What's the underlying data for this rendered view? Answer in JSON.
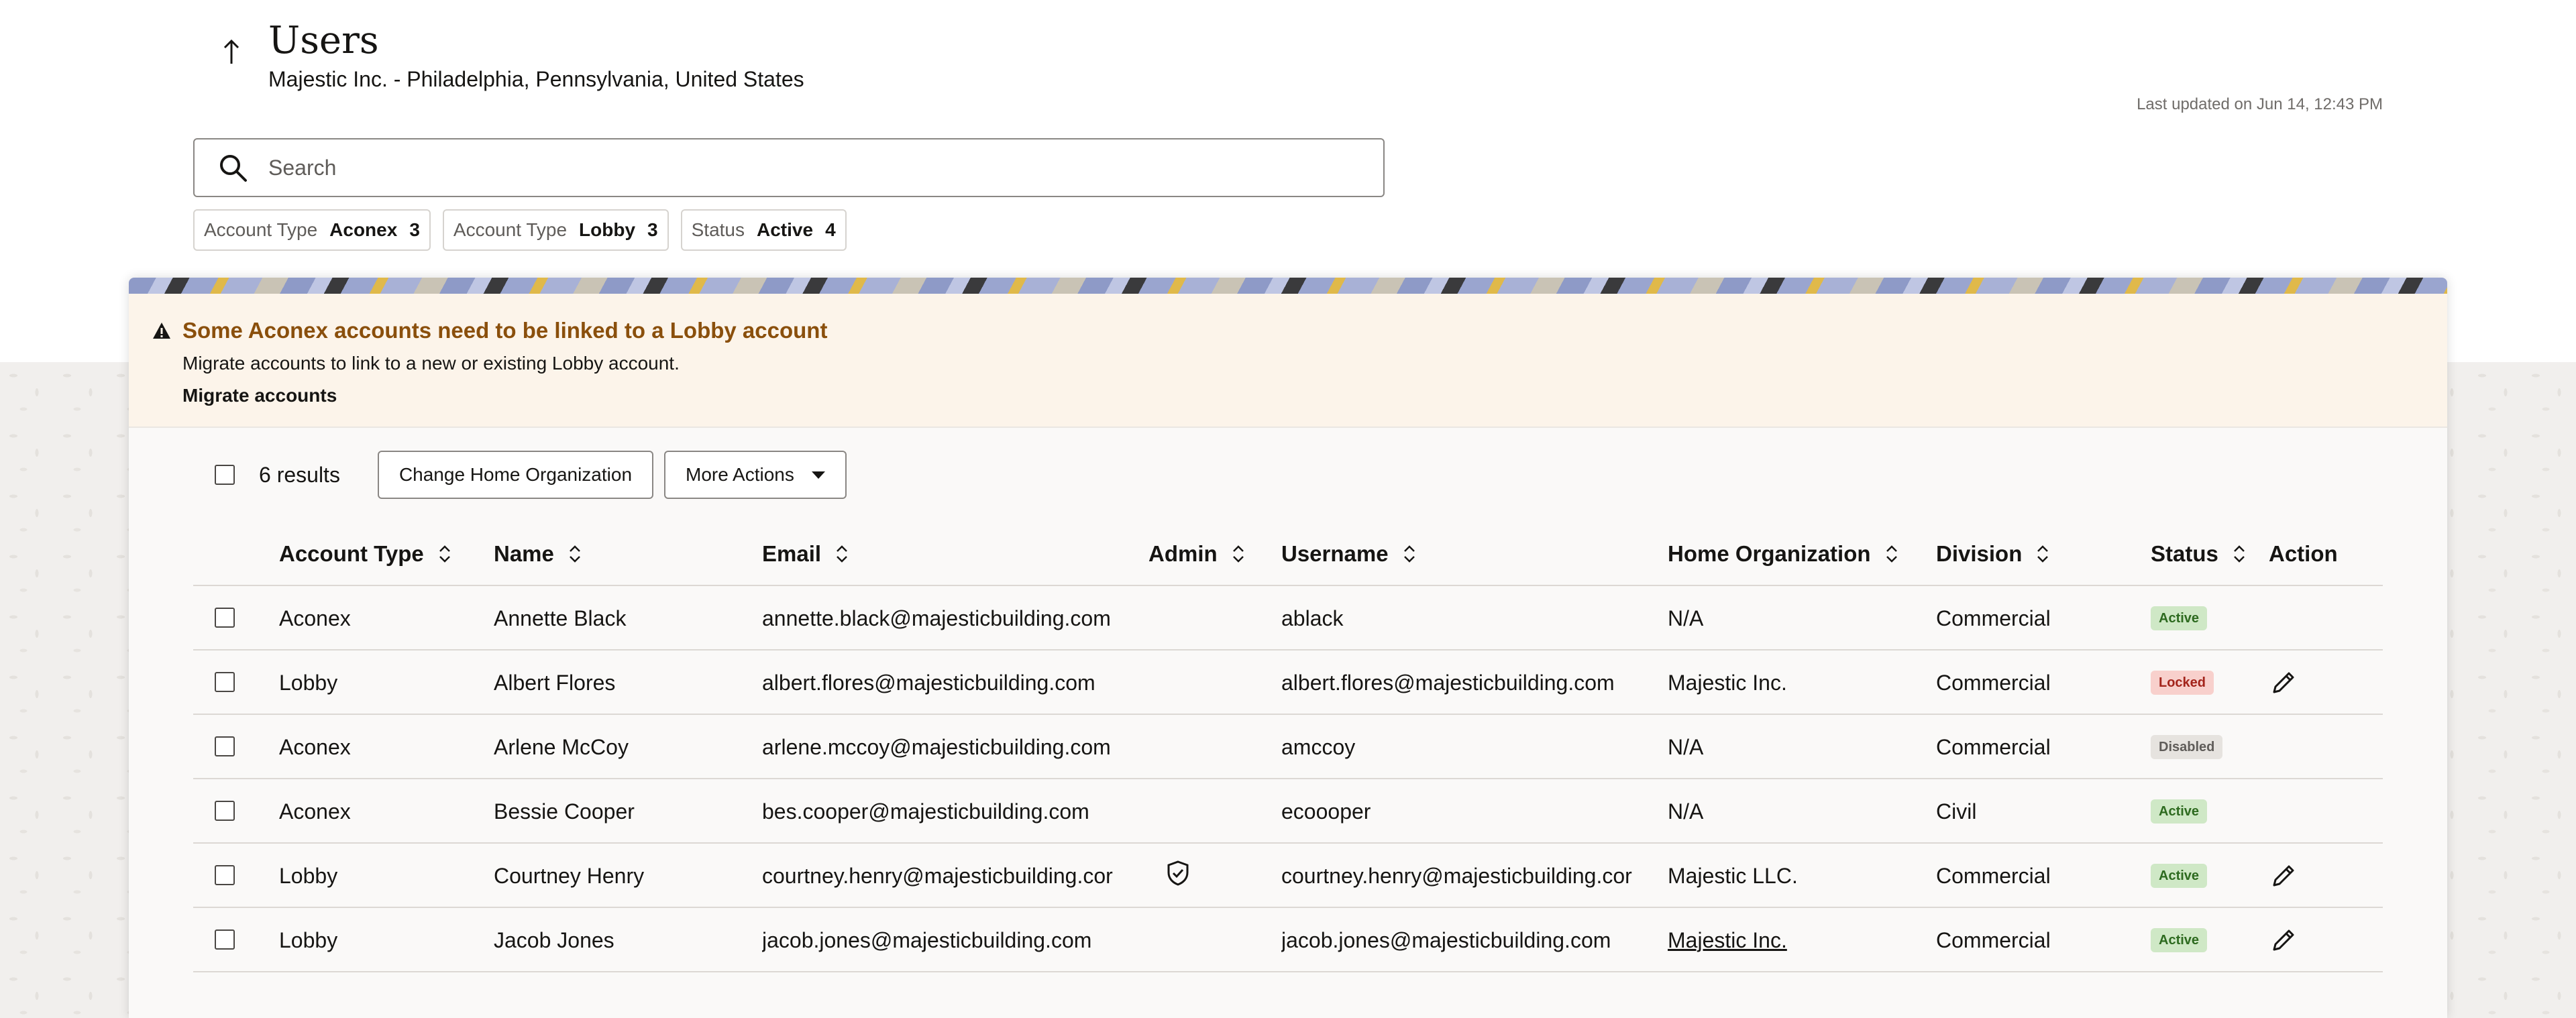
{
  "header": {
    "title": "Users",
    "subtitle": "Majestic Inc. - Philadelphia, Pennsylvania, United States",
    "last_updated": "Last updated on Jun 14, 12:43 PM"
  },
  "search": {
    "placeholder": "Search",
    "value": ""
  },
  "filters": [
    {
      "key": "Account Type",
      "value": "Aconex",
      "count": "3"
    },
    {
      "key": "Account Type",
      "value": "Lobby",
      "count": "3"
    },
    {
      "key": "Status",
      "value": "Active",
      "count": "4"
    }
  ],
  "warning": {
    "title": "Some Aconex accounts need to be linked to a Lobby account",
    "description": "Migrate accounts to link to a new or existing Lobby account.",
    "link": "Migrate accounts",
    "color": "#8a4f0c"
  },
  "toolbar": {
    "results": "6 results",
    "change_org_label": "Change Home Organization",
    "more_actions_label": "More Actions"
  },
  "table": {
    "columns": [
      "Account Type",
      "Name",
      "Email",
      "Admin",
      "Username",
      "Home Organization",
      "Division",
      "Status",
      "Action"
    ],
    "rows": [
      {
        "account_type": "Aconex",
        "name": "Annette Black",
        "email": "annette.black@majesticbuilding.com",
        "admin": false,
        "username": "ablack",
        "home_org": "N/A",
        "division": "Commercial",
        "status": "Active",
        "editable": false
      },
      {
        "account_type": "Lobby",
        "name": "Albert Flores",
        "email": "albert.flores@majesticbuilding.com",
        "admin": false,
        "username": "albert.flores@majesticbuilding.com",
        "home_org": "Majestic Inc.",
        "division": "Commercial",
        "status": "Locked",
        "editable": true
      },
      {
        "account_type": "Aconex",
        "name": "Arlene McCoy",
        "email": "arlene.mccoy@majesticbuilding.com",
        "admin": false,
        "username": "amccoy",
        "home_org": "N/A",
        "division": "Commercial",
        "status": "Disabled",
        "editable": false
      },
      {
        "account_type": "Aconex",
        "name": "Bessie Cooper",
        "email": "bes.cooper@majesticbuilding.com",
        "admin": false,
        "username": "ecoooper",
        "home_org": "N/A",
        "division": "Civil",
        "status": "Active",
        "editable": false
      },
      {
        "account_type": "Lobby",
        "name": "Courtney Henry",
        "email": "courtney.henry@majesticbuilding.cor",
        "admin": true,
        "username": "courtney.henry@majesticbuilding.cor",
        "home_org": "Majestic LLC.",
        "division": "Commercial",
        "status": "Active",
        "editable": true
      },
      {
        "account_type": "Lobby",
        "name": "Jacob Jones",
        "email": "jacob.jones@majesticbuilding.com",
        "admin": false,
        "username": "jacob.jones@majesticbuilding.com",
        "home_org": "Majestic Inc.",
        "home_org_linked": true,
        "division": "Commercial",
        "status": "Active",
        "editable": true
      }
    ]
  },
  "icons": {
    "back": "arrow-up-icon",
    "search": "search-icon",
    "warning": "warning-triangle-icon",
    "sort": "sort-icon",
    "admin": "shield-check-icon",
    "edit": "pencil-icon"
  },
  "colors": {
    "active_bg": "#cfe8c6",
    "active_fg": "#2d6a1f",
    "locked_bg": "#f8d0cc",
    "locked_fg": "#a3241b",
    "disabled_bg": "#e6e3df",
    "disabled_fg": "#5f5c59"
  }
}
